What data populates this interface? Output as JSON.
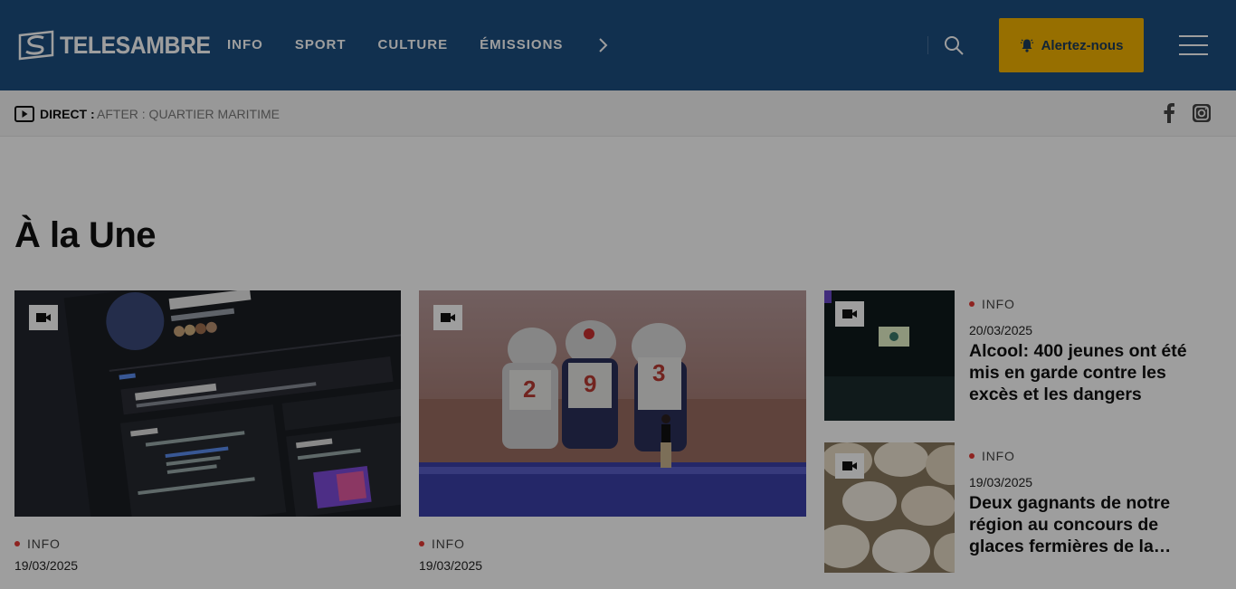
{
  "header": {
    "logo_text": "TELESAMBRE",
    "nav": [
      "INFO",
      "SPORT",
      "CULTURE",
      "ÉMISSIONS"
    ],
    "alert_label": "Alertez-nous",
    "colors": {
      "header_bg": "#1c4e80",
      "alert_bg": "#f4b400"
    }
  },
  "live": {
    "label": "DIRECT :",
    "show": "AFTER : QUARTIER MARITIME"
  },
  "section": {
    "title": "À la Une"
  },
  "articles": [
    {
      "category": "INFO",
      "date": "19/03/2025",
      "thumb": "facebook-page-screenshot"
    },
    {
      "category": "INFO",
      "date": "19/03/2025",
      "thumb": "astronauts-stage"
    },
    {
      "category": "INFO",
      "date": "20/03/2025",
      "title": "Alcool: 400 jeunes ont été mis en garde contre les excès et les dangers",
      "thumb": "auditorium"
    },
    {
      "category": "INFO",
      "date": "19/03/2025",
      "title": "Deux gagnants de notre région au concours de glaces fermières de la…",
      "thumb": "ice-cream-tubs"
    }
  ]
}
